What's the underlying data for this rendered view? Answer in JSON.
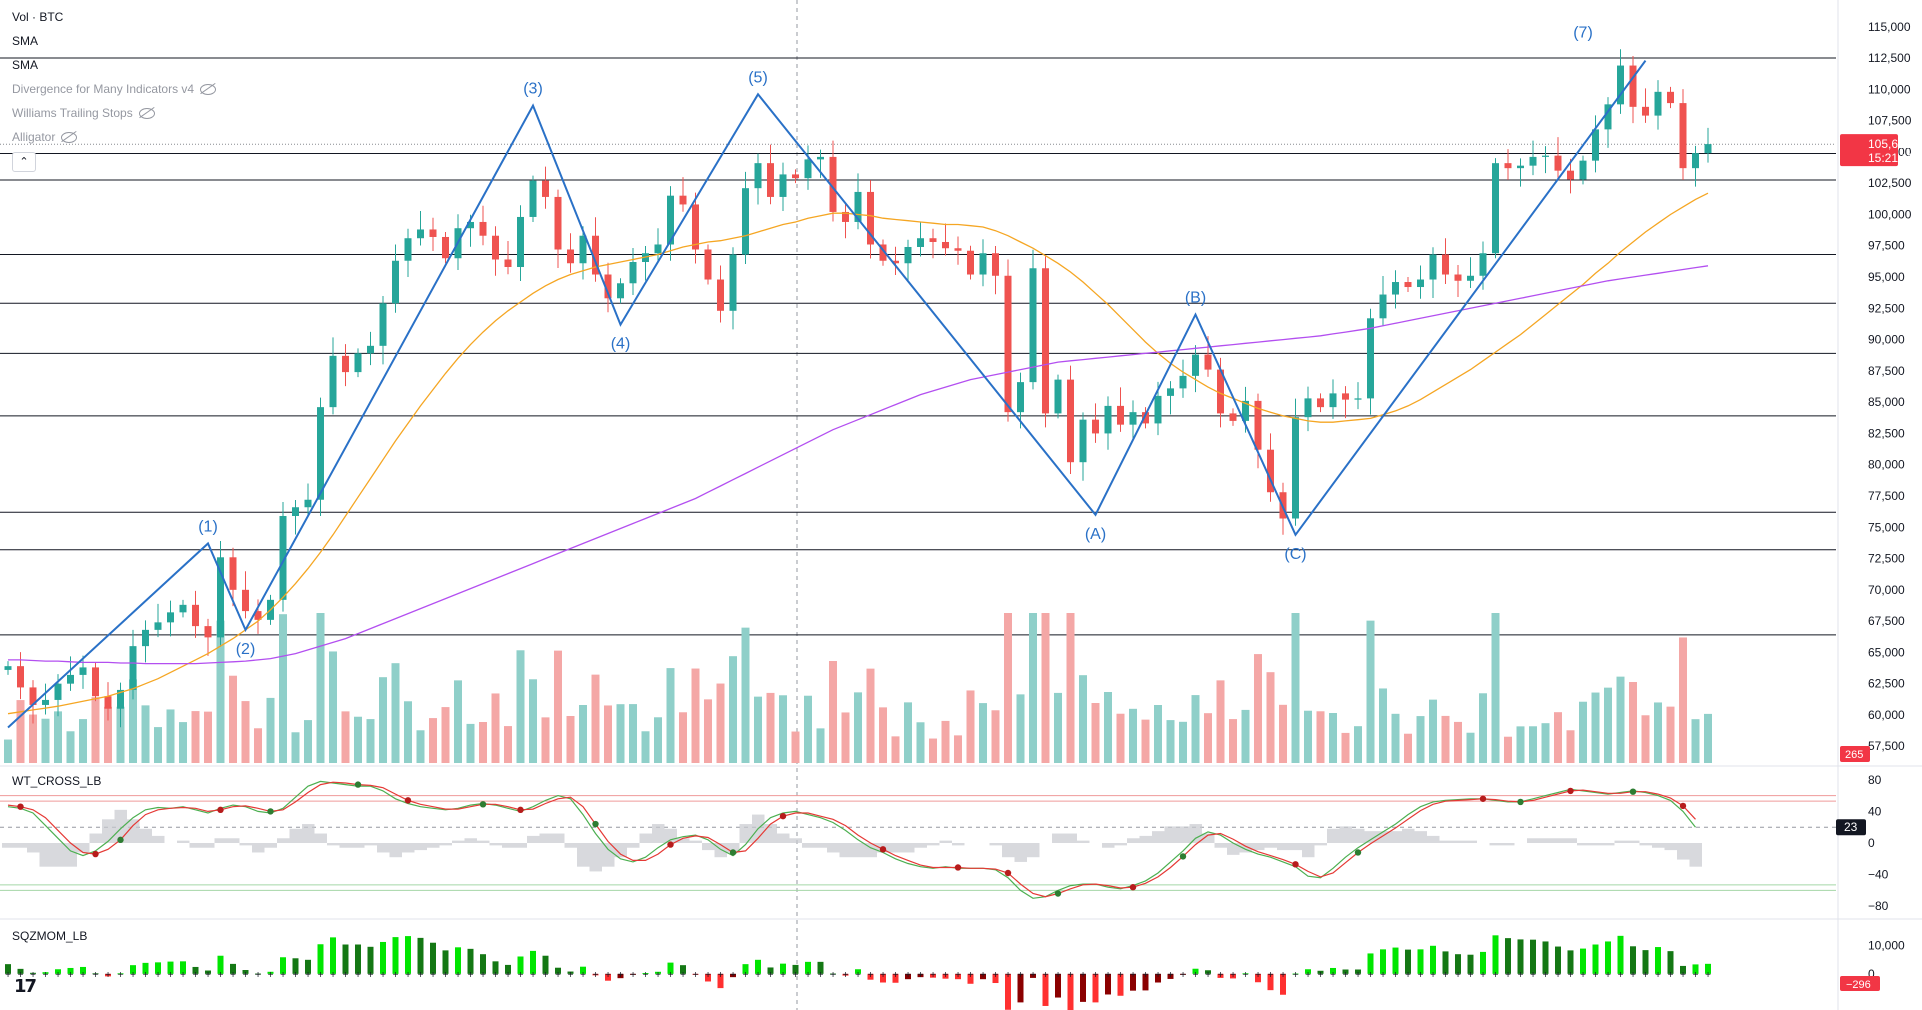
{
  "legend": {
    "symbol": "Vol · BTC",
    "items": [
      {
        "label": "SMA",
        "hidden": false
      },
      {
        "label": "SMA",
        "hidden": false
      },
      {
        "label": "Divergence for Many Indicators v4",
        "hidden": true
      },
      {
        "label": "Williams Trailing Stops",
        "hidden": true
      },
      {
        "label": "Alligator",
        "hidden": true
      }
    ],
    "collapse_glyph": "⌃"
  },
  "panes": {
    "oscillator_title": "WT_CROSS_LB",
    "momentum_title": "SQZMOM_LB"
  },
  "colors": {
    "up": "#26a69a",
    "down": "#ef5350",
    "wave": "#2a71c7",
    "sma_fast": "#f5a623",
    "sma_slow": "#b34ff0",
    "price_badge": "#f23645",
    "wt_green": "#4caf50",
    "wt_red": "#e53935",
    "vol_up": "#8fcfc9",
    "vol_down": "#f4a7a6",
    "mom_up_strong": "#00e600",
    "mom_up_weak": "#147814",
    "mom_down_strong": "#ff3030",
    "mom_down_weak": "#8b0000"
  },
  "chart_data": [
    {
      "type": "candlestick",
      "title": "BTC",
      "y_axis_side": "right",
      "ylim": [
        56000,
        116500
      ],
      "y_ticks": [
        "115,000",
        "112,500",
        "110,000",
        "107,500",
        "105,000",
        "102,500",
        "100,000",
        "97,500",
        "95,000",
        "92,500",
        "90,000",
        "87,500",
        "85,000",
        "82,500",
        "80,000",
        "77,500",
        "75,000",
        "72,500",
        "70,000",
        "67,500",
        "65,000",
        "62,500",
        "60,000",
        "57,500"
      ],
      "last_price": "105,621",
      "countdown": "15:21:11",
      "horizontal_levels": [
        112500,
        104875,
        102750,
        96800,
        92900,
        88900,
        83900,
        76200,
        73200,
        66400
      ],
      "wave_points": [
        {
          "i": 0,
          "price": 59000,
          "label": ""
        },
        {
          "i": 16,
          "price": 73700,
          "label": "(1)"
        },
        {
          "i": 19,
          "price": 66800,
          "label": "(2)"
        },
        {
          "i": 42,
          "price": 108700,
          "label": "(3)"
        },
        {
          "i": 49,
          "price": 91200,
          "label": "(4)"
        },
        {
          "i": 60,
          "price": 109600,
          "label": "(5)"
        },
        {
          "i": 87,
          "price": 76000,
          "label": "(A)"
        },
        {
          "i": 95,
          "price": 92000,
          "label": "(B)"
        },
        {
          "i": 103,
          "price": 74400,
          "label": "(C)"
        },
        {
          "i": 131,
          "price": 112300,
          "label": ""
        }
      ],
      "peak_label": {
        "i": 126,
        "price": 113500,
        "label": "(7)"
      },
      "closes": [
        63900,
        62200,
        60800,
        61200,
        62500,
        63200,
        63800,
        61500,
        60500,
        62000,
        65500,
        66800,
        67400,
        68200,
        68800,
        67100,
        66200,
        72600,
        70000,
        68300,
        67600,
        69200,
        75900,
        76600,
        77200,
        84600,
        88700,
        87400,
        88900,
        89500,
        92900,
        96300,
        98100,
        98800,
        98200,
        96500,
        98900,
        99400,
        98300,
        96400,
        95800,
        99800,
        102700,
        101400,
        97200,
        96100,
        98300,
        95200,
        93300,
        94500,
        96200,
        96900,
        97600,
        101500,
        100800,
        97200,
        94800,
        92300,
        96800,
        102100,
        104100,
        101400,
        103200,
        102900,
        104400,
        104600,
        100200,
        99400,
        101800,
        97600,
        96300,
        96100,
        97400,
        98100,
        97800,
        97300,
        97100,
        95200,
        96900,
        95100,
        84200,
        86600,
        95700,
        84100,
        86800,
        80200,
        83600,
        82500,
        84700,
        83200,
        84200,
        83300,
        85500,
        86100,
        87100,
        88800,
        87600,
        84100,
        83500,
        85100,
        81200,
        77800,
        75700,
        83800,
        85300,
        84600,
        85700,
        85200,
        85300,
        91700,
        93600,
        94600,
        94200,
        94800,
        96800,
        95200,
        94700,
        95100,
        96900,
        104100,
        103700,
        103900,
        104600,
        104700,
        103500,
        102800,
        104300,
        106800,
        108800,
        111900,
        108600,
        107900,
        109800,
        108900,
        103700,
        104900,
        105621
      ],
      "series": [
        {
          "name": "",
          "kind": "sma_fast",
          "values": [
            60100,
            60250,
            60400,
            60550,
            60700,
            60900,
            61100,
            61300,
            61500,
            61800,
            62100,
            62500,
            62900,
            63400,
            63900,
            64400,
            64900,
            65500,
            66100,
            66800,
            67500,
            68400,
            69400,
            70500,
            71700,
            73000,
            74400,
            75900,
            77400,
            78900,
            80400,
            81900,
            83300,
            84700,
            86000,
            87300,
            88500,
            89600,
            90600,
            91500,
            92300,
            93000,
            93700,
            94300,
            94800,
            95200,
            95500,
            95800,
            96000,
            96200,
            96400,
            96600,
            96800,
            97100,
            97400,
            97600,
            97800,
            97900,
            98100,
            98300,
            98600,
            98900,
            99200,
            99400,
            99700,
            99900,
            100100,
            100100,
            100000,
            99900,
            99700,
            99600,
            99500,
            99400,
            99300,
            99200,
            99200,
            99100,
            99000,
            98700,
            98300,
            97800,
            97300,
            96700,
            96100,
            95400,
            94600,
            93700,
            92800,
            91800,
            90800,
            89800,
            88900,
            88100,
            87400,
            86800,
            86200,
            85700,
            85300,
            84900,
            84500,
            84200,
            83900,
            83700,
            83500,
            83400,
            83400,
            83500,
            83600,
            83700,
            84000,
            84300,
            84700,
            85200,
            85800,
            86400,
            87000,
            87600,
            88300,
            89000,
            89700,
            90400,
            91200,
            92000,
            92800,
            93600,
            94400,
            95300,
            96100,
            97000,
            97800,
            98600,
            99300,
            100000,
            100600,
            101200,
            101700
          ]
        },
        {
          "name": "",
          "kind": "sma_slow",
          "values": [
            64400,
            64400,
            64350,
            64300,
            64300,
            64250,
            64200,
            64200,
            64200,
            64150,
            64150,
            64100,
            64100,
            64100,
            64100,
            64100,
            64150,
            64200,
            64250,
            64300,
            64400,
            64500,
            64700,
            64900,
            65200,
            65500,
            65800,
            66100,
            66500,
            66900,
            67300,
            67700,
            68100,
            68500,
            68900,
            69300,
            69700,
            70100,
            70500,
            70900,
            71300,
            71700,
            72100,
            72500,
            72900,
            73300,
            73700,
            74100,
            74500,
            74900,
            75300,
            75700,
            76100,
            76500,
            76900,
            77300,
            77800,
            78300,
            78800,
            79300,
            79800,
            80300,
            80800,
            81300,
            81800,
            82300,
            82800,
            83200,
            83600,
            84000,
            84400,
            84800,
            85200,
            85600,
            85900,
            86200,
            86500,
            86800,
            87000,
            87200,
            87400,
            87600,
            87800,
            88000,
            88200,
            88300,
            88400,
            88500,
            88600,
            88700,
            88800,
            88900,
            89000,
            89100,
            89200,
            89300,
            89400,
            89500,
            89600,
            89700,
            89800,
            89900,
            90000,
            90100,
            90200,
            90300,
            90450,
            90600,
            90750,
            90900,
            91100,
            91300,
            91500,
            91700,
            91900,
            92100,
            92300,
            92500,
            92700,
            92900,
            93100,
            93300,
            93500,
            93700,
            93900,
            94100,
            94300,
            94500,
            94700,
            94850,
            95000,
            95150,
            95300,
            95450,
            95600,
            95750,
            95900
          ]
        }
      ]
    },
    {
      "type": "bar",
      "title": "Vol · BTC",
      "last_value": "265"
    },
    {
      "type": "line",
      "title": "WT_CROSS_LB",
      "ylim": [
        -95,
        95
      ],
      "y_ticks": [
        "80",
        "40",
        "0",
        "−40",
        "−80"
      ],
      "current_value": "23",
      "levels": [
        60,
        53,
        -53,
        -60
      ],
      "series": [
        {
          "name": "",
          "kind": "wt1",
          "values": [
            46,
            44,
            38,
            22,
            6,
            -10,
            -16,
            -10,
            2,
            18,
            32,
            42,
            45,
            44,
            46,
            42,
            38,
            44,
            48,
            46,
            40,
            38,
            44,
            58,
            72,
            78,
            76,
            74,
            72,
            72,
            66,
            56,
            50,
            46,
            44,
            42,
            44,
            48,
            50,
            48,
            44,
            40,
            46,
            54,
            60,
            56,
            36,
            12,
            -8,
            -20,
            -24,
            -18,
            -6,
            4,
            8,
            10,
            4,
            -8,
            -16,
            -2,
            18,
            32,
            38,
            40,
            36,
            32,
            26,
            16,
            4,
            -6,
            -12,
            -20,
            -26,
            -30,
            -32,
            -30,
            -32,
            -32,
            -32,
            -34,
            -44,
            -60,
            -70,
            -68,
            -60,
            -54,
            -52,
            -52,
            -56,
            -58,
            -54,
            -48,
            -38,
            -24,
            -10,
            6,
            14,
            10,
            0,
            -8,
            -14,
            -18,
            -24,
            -30,
            -42,
            -44,
            -32,
            -18,
            -6,
            4,
            14,
            24,
            36,
            46,
            52,
            54,
            55,
            56,
            56,
            54,
            52,
            52,
            56,
            60,
            64,
            68,
            66,
            64,
            62,
            64,
            66,
            64,
            60,
            54,
            40,
            20
          ]
        },
        {
          "name": "",
          "kind": "wt2",
          "values": [
            48,
            46,
            42,
            32,
            16,
            0,
            -12,
            -14,
            -8,
            4,
            22,
            36,
            42,
            44,
            45,
            44,
            40,
            42,
            46,
            47,
            44,
            40,
            42,
            52,
            64,
            74,
            77,
            76,
            74,
            73,
            70,
            62,
            54,
            49,
            46,
            43,
            43,
            46,
            49,
            49,
            46,
            42,
            43,
            50,
            56,
            58,
            46,
            24,
            2,
            -14,
            -22,
            -22,
            -14,
            -2,
            6,
            9,
            7,
            -2,
            -12,
            -10,
            6,
            24,
            34,
            38,
            38,
            34,
            30,
            22,
            10,
            0,
            -8,
            -16,
            -22,
            -28,
            -31,
            -31,
            -31,
            -32,
            -32,
            -33,
            -38,
            -52,
            -64,
            -68,
            -64,
            -58,
            -53,
            -52,
            -54,
            -57,
            -56,
            -51,
            -43,
            -31,
            -17,
            -2,
            10,
            12,
            5,
            -4,
            -11,
            -16,
            -21,
            -27,
            -36,
            -43,
            -38,
            -25,
            -12,
            -1,
            9,
            19,
            30,
            41,
            49,
            53,
            54,
            55,
            56,
            55,
            53,
            52,
            54,
            58,
            62,
            66,
            67,
            65,
            63,
            63,
            65,
            65,
            62,
            57,
            47,
            30
          ]
        }
      ],
      "crosses": [
        {
          "i": 1,
          "color": "red"
        },
        {
          "i": 7,
          "color": "red"
        },
        {
          "i": 9,
          "color": "green"
        },
        {
          "i": 17,
          "color": "red"
        },
        {
          "i": 21,
          "color": "green"
        },
        {
          "i": 28,
          "color": "green"
        },
        {
          "i": 32,
          "color": "red"
        },
        {
          "i": 38,
          "color": "green"
        },
        {
          "i": 41,
          "color": "red"
        },
        {
          "i": 47,
          "color": "green"
        },
        {
          "i": 53,
          "color": "red"
        },
        {
          "i": 58,
          "color": "green"
        },
        {
          "i": 62,
          "color": "red"
        },
        {
          "i": 70,
          "color": "red"
        },
        {
          "i": 76,
          "color": "red"
        },
        {
          "i": 80,
          "color": "red"
        },
        {
          "i": 84,
          "color": "green"
        },
        {
          "i": 90,
          "color": "red"
        },
        {
          "i": 94,
          "color": "green"
        },
        {
          "i": 103,
          "color": "red"
        },
        {
          "i": 108,
          "color": "green"
        },
        {
          "i": 118,
          "color": "red"
        },
        {
          "i": 121,
          "color": "green"
        },
        {
          "i": 125,
          "color": "red"
        },
        {
          "i": 130,
          "color": "green"
        },
        {
          "i": 134,
          "color": "red"
        }
      ]
    },
    {
      "type": "bar",
      "title": "SQZMOM_LB",
      "ylim": [
        -11000,
        19000
      ],
      "y_ticks": [
        "10,000",
        "0"
      ],
      "current_value": "0",
      "last_value": "−296"
    }
  ]
}
